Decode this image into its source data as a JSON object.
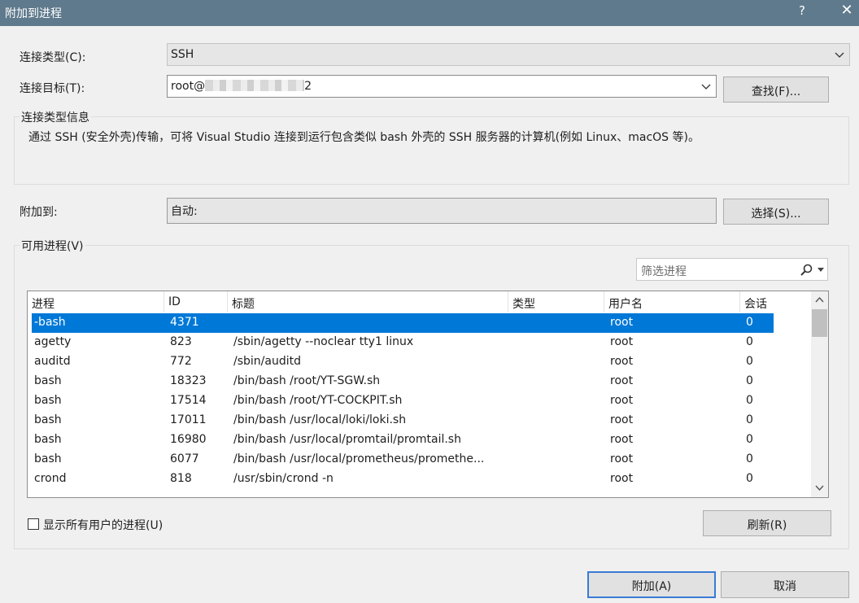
{
  "window": {
    "title": "附加到进程",
    "help_label": "?",
    "close_label": "✕"
  },
  "connection": {
    "type_label": "连接类型(C):",
    "type_value": "SSH",
    "target_label": "连接目标(T):",
    "target_prefix": "root@",
    "target_suffix": "2",
    "find_button": "查找(F)..."
  },
  "info": {
    "title": "连接类型信息",
    "text": "通过 SSH (安全外壳)传输，可将 Visual Studio 连接到运行包含类似 bash 外壳的 SSH 服务器的计算机(例如 Linux、macOS 等)。"
  },
  "attach_to": {
    "label": "附加到:",
    "value": "自动:",
    "select_button": "选择(S)..."
  },
  "processes": {
    "title": "可用进程(V)",
    "filter_placeholder": "筛选进程",
    "columns": [
      "进程",
      "ID",
      "标题",
      "类型",
      "用户名",
      "会话"
    ],
    "rows": [
      {
        "process": "-bash",
        "id": "4371",
        "title": "",
        "type": "",
        "user": "root",
        "session": "0",
        "selected": true
      },
      {
        "process": "agetty",
        "id": "823",
        "title": "/sbin/agetty --noclear tty1 linux",
        "type": "",
        "user": "root",
        "session": "0"
      },
      {
        "process": "auditd",
        "id": "772",
        "title": "/sbin/auditd",
        "type": "",
        "user": "root",
        "session": "0"
      },
      {
        "process": "bash",
        "id": "18323",
        "title": "/bin/bash /root/YT-SGW.sh",
        "type": "",
        "user": "root",
        "session": "0"
      },
      {
        "process": "bash",
        "id": "17514",
        "title": "/bin/bash /root/YT-COCKPIT.sh",
        "type": "",
        "user": "root",
        "session": "0"
      },
      {
        "process": "bash",
        "id": "17011",
        "title": "/bin/bash /usr/local/loki/loki.sh",
        "type": "",
        "user": "root",
        "session": "0"
      },
      {
        "process": "bash",
        "id": "16980",
        "title": "/bin/bash /usr/local/promtail/promtail.sh",
        "type": "",
        "user": "root",
        "session": "0"
      },
      {
        "process": "bash",
        "id": "6077",
        "title": "/bin/bash /usr/local/prometheus/promethe...",
        "type": "",
        "user": "root",
        "session": "0"
      },
      {
        "process": "crond",
        "id": "818",
        "title": "/usr/sbin/crond -n",
        "type": "",
        "user": "root",
        "session": "0"
      }
    ],
    "show_all_label": "显示所有用户的进程(U)",
    "show_all_checked": false,
    "refresh_button": "刷新(R)"
  },
  "footer": {
    "attach_button": "附加(A)",
    "cancel_button": "取消"
  },
  "colors": {
    "titlebar": "#5f7a8c",
    "selection": "#0078d7",
    "background": "#f0f0f0"
  }
}
